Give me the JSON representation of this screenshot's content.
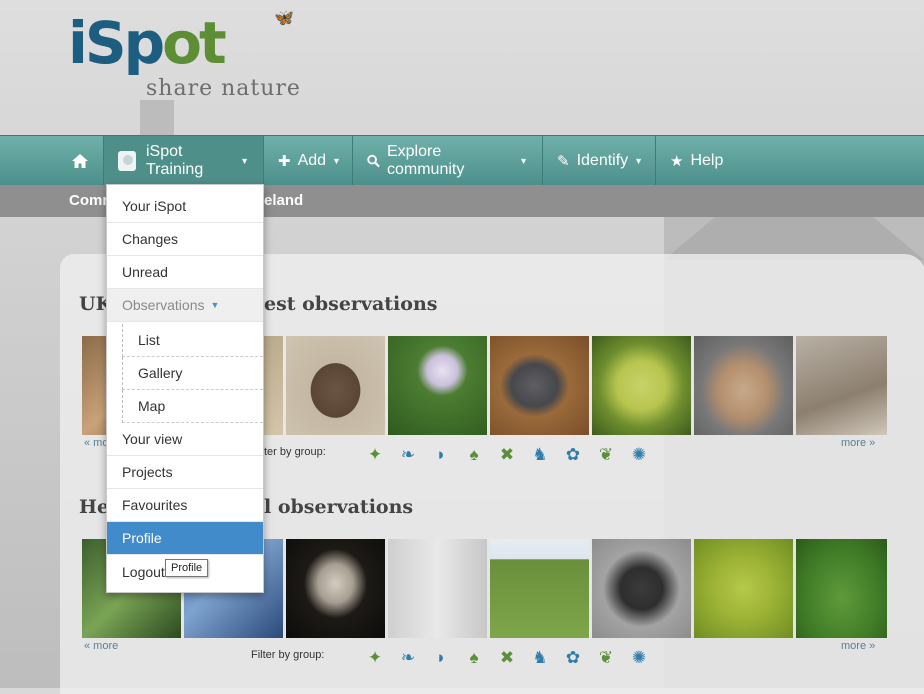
{
  "logo": {
    "name": "iSpot",
    "tagline": "share nature"
  },
  "nav": {
    "home_icon": "home-icon",
    "user_label": "iSpot Training",
    "add_label": "Add",
    "explore_label": "Explore community",
    "identify_label": "Identify",
    "help_label": "Help"
  },
  "subbar": {
    "left_text": "Comm",
    "right_text": "eland"
  },
  "dropdown": {
    "items": [
      "Your iSpot",
      "Changes",
      "Unread",
      "Observations",
      "List",
      "Gallery",
      "Map",
      "Your view",
      "Projects",
      "Favourites",
      "Profile",
      "Logout"
    ],
    "active": "Profile",
    "tooltip": "Profile"
  },
  "section1": {
    "title_left": "UK",
    "title_right": "est observations",
    "more_left": "« mo",
    "more_right": "more »",
    "filter_label": "ter by group:"
  },
  "section2": {
    "title_left": "He",
    "title_right": "l observations",
    "more_left": "« more",
    "more_right": "more »",
    "filter_label": "Filter by group:"
  },
  "group_icons": [
    {
      "name": "amphibian-icon",
      "color": "#5b8f3a"
    },
    {
      "name": "bird-icon",
      "color": "#2f7ea9"
    },
    {
      "name": "fish-icon",
      "color": "#2f7ea9"
    },
    {
      "name": "fungi-icon",
      "color": "#5b8f3a"
    },
    {
      "name": "insect-icon",
      "color": "#5b8f3a"
    },
    {
      "name": "mammal-icon",
      "color": "#2f7ea9"
    },
    {
      "name": "invertebrate-icon",
      "color": "#2f7ea9"
    },
    {
      "name": "plant-icon",
      "color": "#5b8f3a"
    },
    {
      "name": "other-icon",
      "color": "#2f7ea9"
    }
  ],
  "colors": {
    "nav": "#5a9d98",
    "active": "#428bca"
  }
}
